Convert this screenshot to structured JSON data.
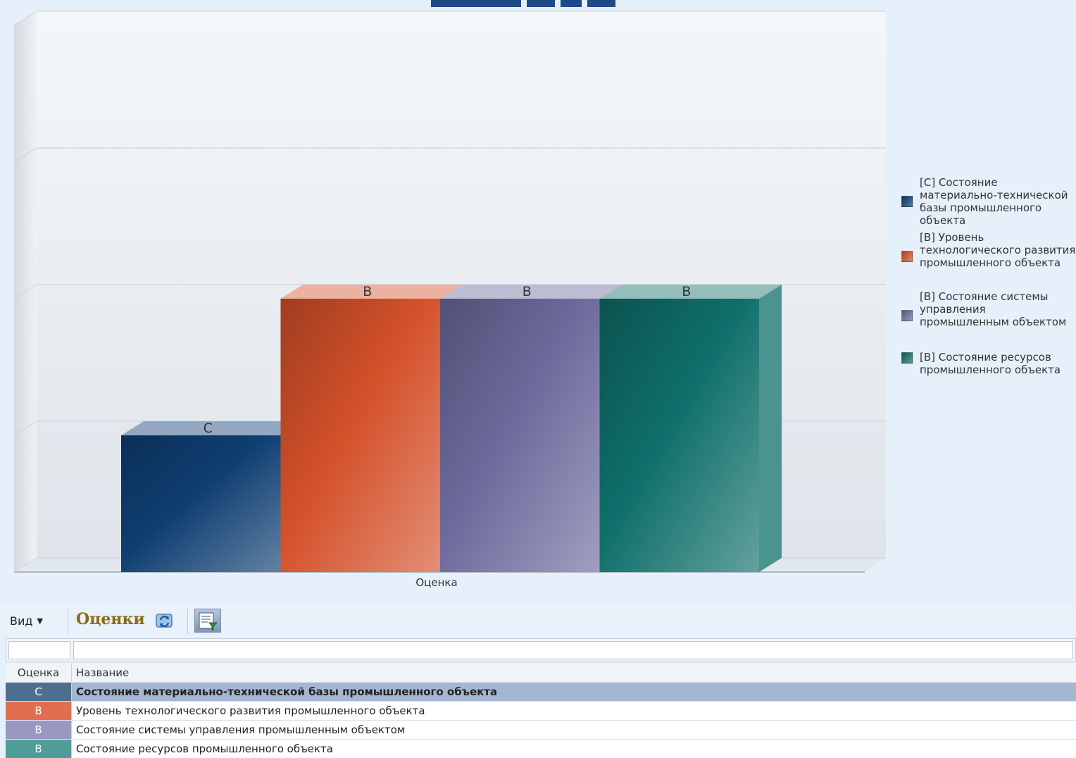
{
  "chart_data": {
    "type": "bar",
    "categories": [
      "Оценка"
    ],
    "xlabel": "Оценка",
    "title": "",
    "ylabel": "",
    "levels": [
      "",
      "C",
      "B",
      ""
    ],
    "series": [
      {
        "name": "[C] Состояние материально-технической базы промышленного объекта",
        "label": "C",
        "level": 1,
        "color": "#0f3e72"
      },
      {
        "name": "[B] Уровень технологического развития промышленного объекта",
        "label": "B",
        "level": 2,
        "color": "#d4512a"
      },
      {
        "name": "[B] Состояние системы управления промышленным объектом",
        "label": "B",
        "level": 2,
        "color": "#6d6a9c"
      },
      {
        "name": "[B] Состояние ресурсов промышленного объекта",
        "label": "B",
        "level": 2,
        "color": "#0f6f6a"
      }
    ],
    "grid": true,
    "legend_position": "right"
  },
  "toolbar": {
    "view_label": "Вид",
    "title": "Оценки"
  },
  "grid": {
    "headers": [
      "Оценка",
      "Название"
    ],
    "rows": [
      {
        "grade": "C",
        "name": "Состояние материально-технической базы промышленного объекта",
        "color": "#4f6f8f",
        "selected": true
      },
      {
        "grade": "B",
        "name": "Уровень технологического развития промышленного объекта",
        "color": "#e06f4f"
      },
      {
        "grade": "B",
        "name": "Состояние системы управления промышленным объектом",
        "color": "#9a98c0"
      },
      {
        "grade": "B",
        "name": "Состояние ресурсов промышленного объекта",
        "color": "#4f9d98"
      }
    ]
  }
}
